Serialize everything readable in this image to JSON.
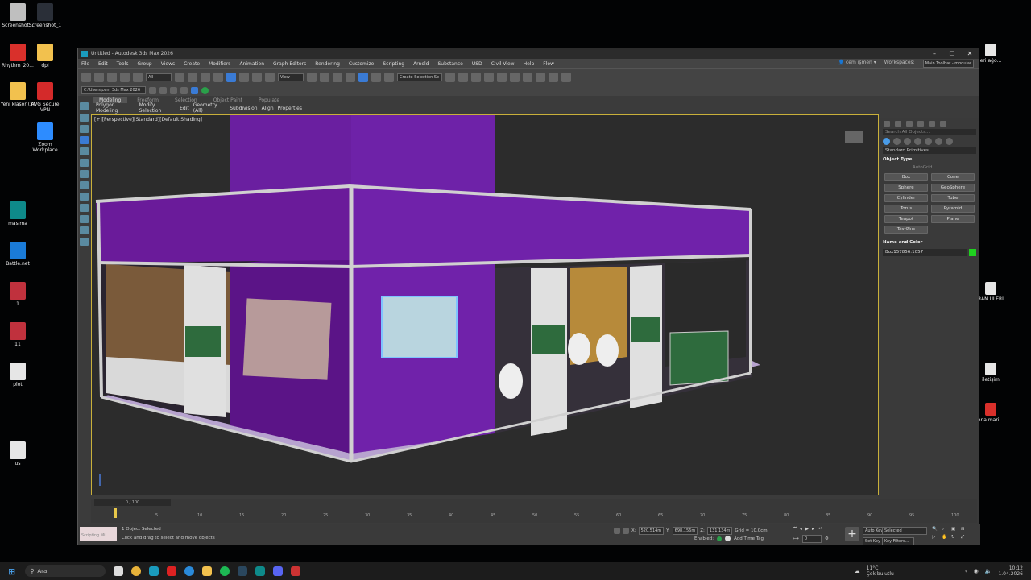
{
  "desktop": {
    "icons_left": [
      {
        "label": "Screenshot...",
        "icon": "screenshot-icon",
        "color": "#bfbfbf"
      },
      {
        "label": "Screenshot_1",
        "icon": "screenshot-icon",
        "color": "#2a2f38"
      },
      {
        "label": "Rhythm_20...",
        "icon": "pdf-icon",
        "color": "#d9302b"
      },
      {
        "label": "dpi",
        "icon": "folder-icon",
        "color": "#f2c14e"
      },
      {
        "label": "Yeni klasör (3)",
        "icon": "folder-icon",
        "color": "#f2c14e"
      },
      {
        "label": "AVG Secure VPN",
        "icon": "avg-icon",
        "color": "#d42a2a"
      },
      {
        "label": "Zoom Workplace",
        "icon": "zoom-icon",
        "color": "#2d8cff"
      },
      {
        "label": "masima",
        "icon": "3dsmax-icon",
        "color": "#0e8a8a"
      },
      {
        "label": "Battle.net",
        "icon": "battlenet-icon",
        "color": "#1a7bd8"
      },
      {
        "label": "1",
        "icon": "access-icon",
        "color": "#c0313d"
      },
      {
        "label": "11",
        "icon": "access-icon",
        "color": "#c0313d"
      },
      {
        "label": "plot",
        "icon": "file-icon",
        "color": "#e6e6e6"
      },
      {
        "label": "us",
        "icon": "file-icon",
        "color": "#e6e6e6"
      }
    ],
    "icons_right": [
      {
        "label": "eri ağo...",
        "icon": "file-icon"
      },
      {
        "label": "RAN ÜLERİ",
        "icon": "file-icon"
      },
      {
        "label": "iletişim",
        "icon": "file-icon"
      },
      {
        "label": "ona mari...",
        "icon": "pdf-icon"
      }
    ]
  },
  "window": {
    "title": "Untitled - Autodesk 3ds Max 2026",
    "menu": [
      "File",
      "Edit",
      "Tools",
      "Group",
      "Views",
      "Create",
      "Modifiers",
      "Animation",
      "Graph Editors",
      "Rendering",
      "Customize",
      "Scripting",
      "Arnold",
      "Substance",
      "USD",
      "Civil View",
      "Help",
      "Flow"
    ],
    "user": "cem işmen",
    "workspaces_label": "Workspaces:",
    "workspace": "Main Toolbar - modular",
    "filter_all": "All",
    "view_dropdown": "View",
    "selection_set": "Create Selection Se",
    "project_path": "C:\\Users\\cem  3ds Max 2026"
  },
  "ribbon": {
    "tabs": [
      "Modeling",
      "Freeform",
      "Selection",
      "Object Paint",
      "Populate"
    ],
    "items": [
      "Polygon Modeling",
      "Modify Selection",
      "Edit",
      "Geometry (All)",
      "Subdivision",
      "Align",
      "Properties"
    ]
  },
  "viewport": {
    "label": "[+][Perspective][Standard][Default Shading]",
    "booth_colors": {
      "purple": "#6a1b9a",
      "purple_dark": "#5b1487",
      "frame": "#c8c8c8",
      "green": "#2e6b3d",
      "floor": "#b49ac9"
    }
  },
  "command_panel": {
    "search_placeholder": "Search All Objects...",
    "category": "Standard Primitives",
    "object_type_title": "Object Type",
    "autogrid": "AutoGrid",
    "primitives": [
      "Box",
      "Cone",
      "Sphere",
      "GeoSphere",
      "Cylinder",
      "Tube",
      "Torus",
      "Pyramid",
      "Teapot",
      "Plane",
      "TextPlus"
    ],
    "name_color_title": "Name and Color",
    "object_name": "Box157856:1057",
    "object_color": "#1fd11f"
  },
  "timeline": {
    "slider_text": "0 / 100",
    "ticks": [
      "0",
      "5",
      "10",
      "15",
      "20",
      "25",
      "30",
      "35",
      "40",
      "45",
      "50",
      "55",
      "60",
      "65",
      "70",
      "75",
      "80",
      "85",
      "90",
      "95",
      "100"
    ]
  },
  "status": {
    "script_label": "Scripting Mi",
    "selection": "1 Object Selected",
    "prompt": "Click and drag to select and move objects",
    "x_label": "X:",
    "x": "520,514m",
    "y_label": "Y:",
    "y": "698,156m",
    "z_label": "Z:",
    "z": "131,134m",
    "grid": "Grid = 10,0cm",
    "enabled": "Enabled:",
    "add_time_tag": "Add Time Tag",
    "auto_key": "Auto Key",
    "set_key": "Set Key",
    "selected_dd": "Selected",
    "key_filters": "Key Filters...",
    "frame": "0"
  },
  "taskbar": {
    "search": "Ara",
    "weather_temp": "11°C",
    "weather_desc": "Çok bulutlu",
    "time": "10:12",
    "date": "1.04.2026"
  }
}
